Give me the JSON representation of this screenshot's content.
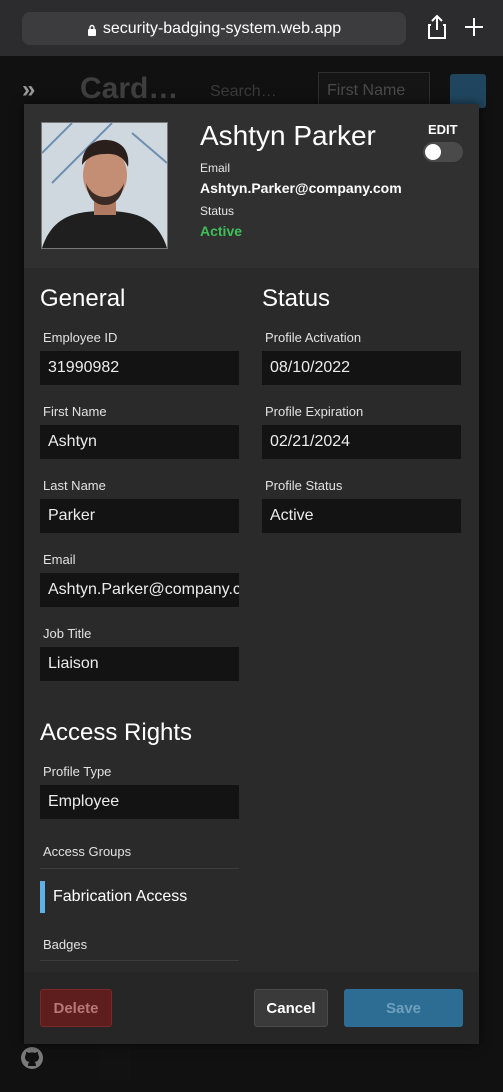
{
  "browser": {
    "url": "security-badging-system.web.app"
  },
  "background": {
    "expand_icon": "»",
    "title": "Card…",
    "search_placeholder": "Search…",
    "first_name_placeholder": "First Name"
  },
  "profile": {
    "name": "Ashtyn Parker",
    "email_label": "Email",
    "email": "Ashtyn.Parker@company.com",
    "status_label": "Status",
    "status": "Active",
    "edit_label": "EDIT",
    "edit_enabled": false
  },
  "general": {
    "title": "General",
    "employee_id": {
      "label": "Employee ID",
      "value": "31990982"
    },
    "first_name": {
      "label": "First Name",
      "value": "Ashtyn"
    },
    "last_name": {
      "label": "Last Name",
      "value": "Parker"
    },
    "email": {
      "label": "Email",
      "value": "Ashtyn.Parker@company.com"
    },
    "job_title": {
      "label": "Job Title",
      "value": "Liaison"
    }
  },
  "status_section": {
    "title": "Status",
    "activation": {
      "label": "Profile Activation",
      "value": "08/10/2022"
    },
    "expiration": {
      "label": "Profile Expiration",
      "value": "02/21/2024"
    },
    "profile_status": {
      "label": "Profile Status",
      "value": "Active"
    }
  },
  "access": {
    "title": "Access Rights",
    "profile_type": {
      "label": "Profile Type",
      "value": "Employee"
    },
    "groups_label": "Access Groups",
    "groups": [
      "Fabrication Access"
    ],
    "badges_label": "Badges"
  },
  "footer": {
    "delete": "Delete",
    "cancel": "Cancel",
    "save": "Save"
  },
  "colors": {
    "status_active": "#3fbf5a",
    "accent": "#5fb0e6",
    "save_button": "#2e6d93",
    "delete_button": "#5e1e1e"
  }
}
